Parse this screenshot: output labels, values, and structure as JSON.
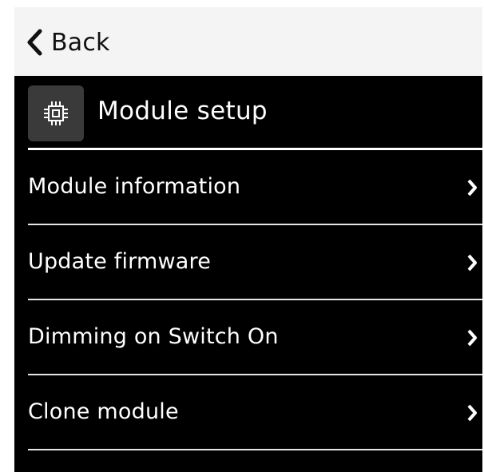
{
  "topbar": {
    "back_label": "Back",
    "back_icon": "chevron-left-icon"
  },
  "header": {
    "title": "Module setup",
    "icon": "chip-icon"
  },
  "menu": {
    "items": [
      {
        "label": "Module information",
        "icon": "chevron-right-icon"
      },
      {
        "label": "Update firmware",
        "icon": "chevron-right-icon"
      },
      {
        "label": "Dimming on Switch On",
        "icon": "chevron-right-icon"
      },
      {
        "label": "Clone module",
        "icon": "chevron-right-icon"
      }
    ]
  },
  "colors": {
    "background": "#000000",
    "topbar": "#f4f4f4",
    "text": "#ffffff",
    "icon_tile": "#3a3a3a"
  }
}
